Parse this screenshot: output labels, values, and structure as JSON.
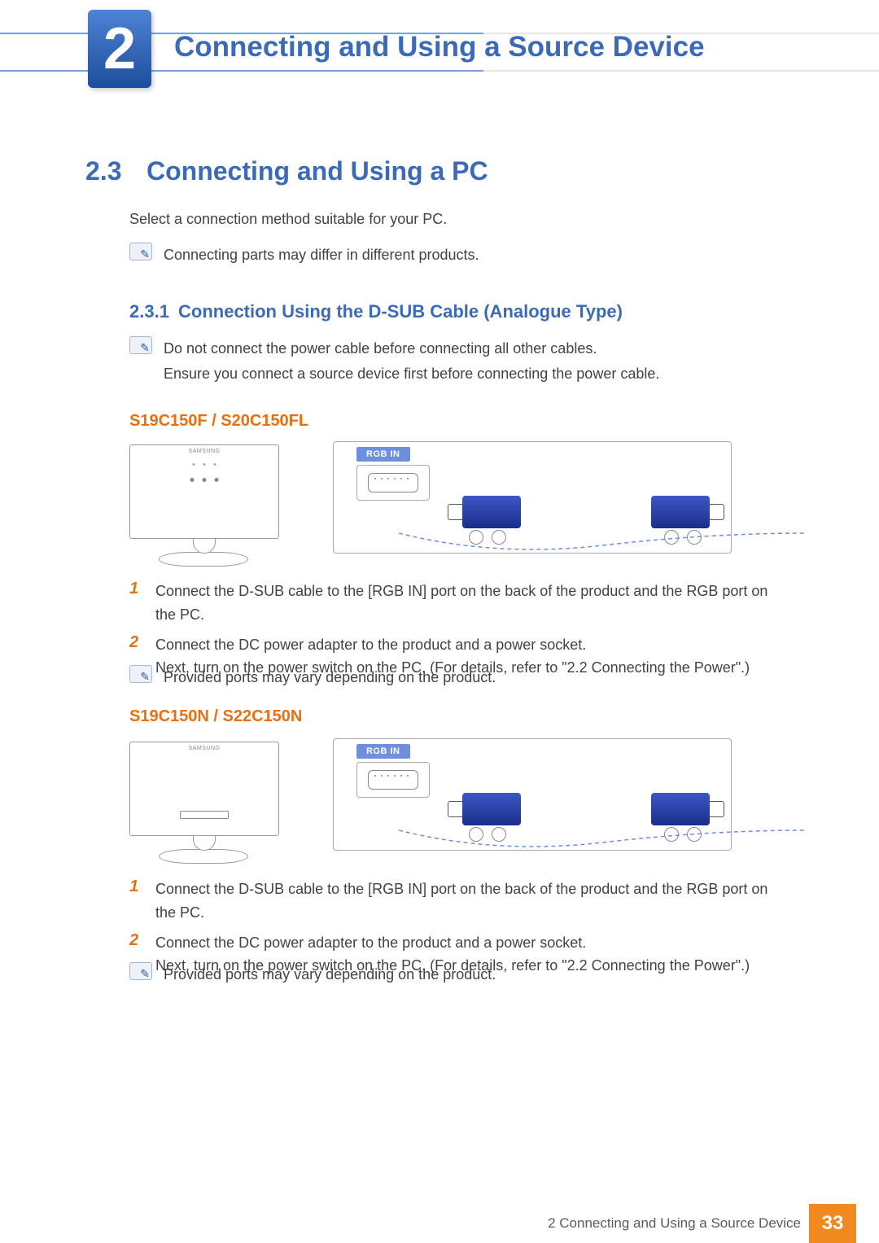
{
  "chapter": {
    "number": "2",
    "title": "Connecting and Using a Source Device"
  },
  "section": {
    "number": "2.3",
    "title": "Connecting and Using a PC"
  },
  "intro_text": "Select a connection method suitable for your PC.",
  "note_intro": "Connecting parts may differ in different products.",
  "subsection": {
    "number": "2.3.1",
    "title": "Connection Using the D-SUB Cable (Analogue Type)"
  },
  "note_power": {
    "line1": "Do not connect the power cable before connecting all other cables.",
    "line2": "Ensure you connect a source device first before connecting the power cable."
  },
  "models": {
    "a": "S19C150F / S20C150FL",
    "b": "S19C150N / S22C150N"
  },
  "diagram": {
    "port_label": "RGB IN",
    "brand": "SAMSUNG"
  },
  "steps": {
    "s1": "Connect the D-SUB cable to the [RGB IN] port on the back of the product and the RGB port on the PC.",
    "s2a": "Connect the DC power adapter to the product and a power socket.",
    "s2b": "Next, turn on the power switch on the PC. (For details, refer to \"2.2 Connecting the Power\".)"
  },
  "note_ports": "Provided ports may vary depending on the product.",
  "footer": {
    "label": "2 Connecting and Using a Source Device",
    "page": "33"
  }
}
